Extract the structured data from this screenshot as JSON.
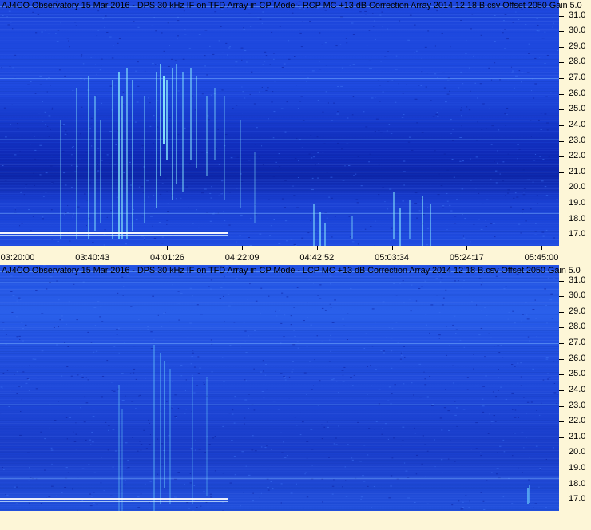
{
  "chart_data": [
    {
      "type": "heatmap",
      "title": "AJ4CO Observatory 15 Mar 2016 - DPS 30 kHz IF on TFD Array in CP Mode - RCP  MC +13 dB  Correction Array 2014 12 18 B.csv  Offset 2050  Gain 5.0",
      "x_tick_labels": [
        "03:20:00",
        "03:40:43",
        "04:01:26",
        "04:22:09",
        "04:42:52",
        "05:03:34",
        "05:24:17",
        "05:45:00"
      ],
      "y_tick_labels": [
        "31.0",
        "30.0",
        "29.0",
        "28.0",
        "27.0",
        "26.0",
        "25.0",
        "24.0",
        "23.0",
        "22.0",
        "21.0",
        "20.0",
        "19.0",
        "18.0",
        "17.0"
      ],
      "ylim": [
        16.3,
        32.0
      ],
      "colors": {
        "background": "#1a3fd6",
        "emission": "#9ff7ff"
      }
    },
    {
      "type": "heatmap",
      "title": "AJ4CO Observatory 15 Mar 2016 - DPS 30 kHz IF on TFD Array in CP Mode - LCP  MC +13 dB  Correction Array 2014 12 18 B.csv  Offset 2050  Gain 5.0",
      "x_tick_labels": [],
      "y_tick_labels": [
        "31.0",
        "30.0",
        "29.0",
        "28.0",
        "27.0",
        "26.0",
        "25.0",
        "24.0",
        "23.0",
        "22.0",
        "21.0",
        "20.0",
        "19.0",
        "18.0",
        "17.0"
      ],
      "ylim": [
        16.3,
        32.0
      ],
      "colors": {
        "background": "#1f48d8",
        "emission": "#6fd6ff"
      }
    }
  ]
}
